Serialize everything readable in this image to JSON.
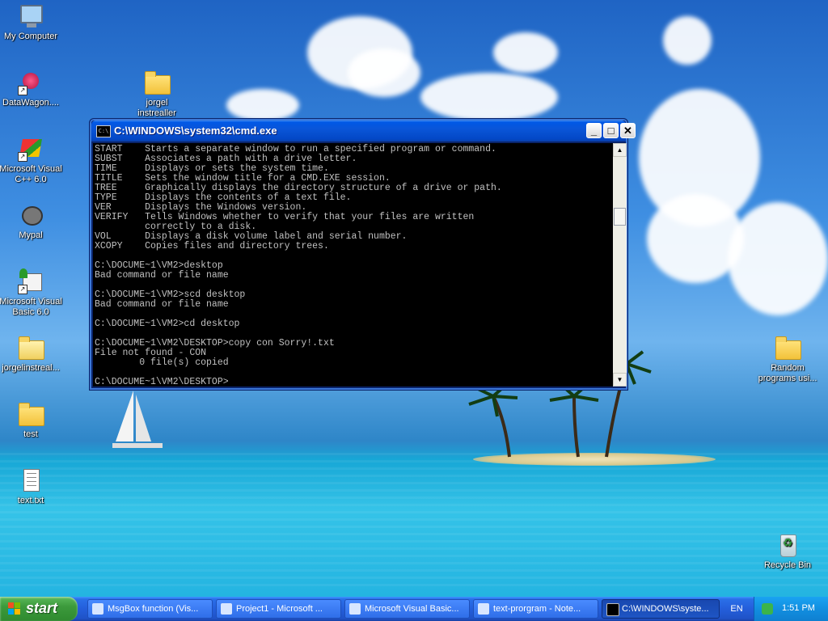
{
  "desktop": {
    "icons": [
      {
        "label": "My Computer",
        "icon": "my-computer-icon"
      },
      {
        "label": "DataWagon....",
        "icon": "datawagon-icon"
      },
      {
        "label": "jorgel instrealler",
        "icon": "folder-icon"
      },
      {
        "label": "Microsoft Visual C++ 6.0",
        "icon": "visual-cpp-icon"
      },
      {
        "label": "Mypal",
        "icon": "mypal-icon"
      },
      {
        "label": "Microsoft Visual Basic 6.0",
        "icon": "visual-basic-icon"
      },
      {
        "label": "jorgelinstreal...",
        "icon": "installer-icon"
      },
      {
        "label": "test",
        "icon": "folder-icon"
      },
      {
        "label": "text.txt",
        "icon": "text-file-icon"
      },
      {
        "label": "Random programs usi...",
        "icon": "folder-icon"
      },
      {
        "label": "Recycle Bin",
        "icon": "recycle-bin-icon"
      }
    ]
  },
  "cmd_window": {
    "title": "C:\\WINDOWS\\system32\\cmd.exe",
    "app_icon_text": "C:\\",
    "buttons": {
      "minimize": "_",
      "maximize": "□",
      "close": "✕"
    },
    "lines": [
      "START    Starts a separate window to run a specified program or command.",
      "SUBST    Associates a path with a drive letter.",
      "TIME     Displays or sets the system time.",
      "TITLE    Sets the window title for a CMD.EXE session.",
      "TREE     Graphically displays the directory structure of a drive or path.",
      "TYPE     Displays the contents of a text file.",
      "VER      Displays the Windows version.",
      "VERIFY   Tells Windows whether to verify that your files are written",
      "         correctly to a disk.",
      "VOL      Displays a disk volume label and serial number.",
      "XCOPY    Copies files and directory trees.",
      "",
      "C:\\DOCUME~1\\VM2>desktop",
      "Bad command or file name",
      "",
      "C:\\DOCUME~1\\VM2>scd desktop",
      "Bad command or file name",
      "",
      "C:\\DOCUME~1\\VM2>cd desktop",
      "",
      "C:\\DOCUME~1\\VM2\\DESKTOP>copy con Sorry!.txt",
      "File not found - CON",
      "        0 file(s) copied",
      "",
      "C:\\DOCUME~1\\VM2\\DESKTOP>"
    ]
  },
  "taskbar": {
    "start_label": "start",
    "tasks": [
      {
        "label": "MsgBox function (Vis...",
        "icon": "browser-icon",
        "active": false
      },
      {
        "label": "Project1 - Microsoft ...",
        "icon": "visual-basic-icon",
        "active": false
      },
      {
        "label": "Microsoft Visual Basic...",
        "icon": "visual-basic-icon",
        "active": false
      },
      {
        "label": "text-prorgram - Note...",
        "icon": "notepad-icon",
        "active": false
      },
      {
        "label": "C:\\WINDOWS\\syste...",
        "icon": "cmd-icon",
        "active": true
      }
    ],
    "language": "EN",
    "clock": "1:51 PM"
  },
  "colors": {
    "titlebar": "#0054e3",
    "taskbar": "#245edb",
    "start_button": "#3c9a3c",
    "console_text": "#c0c0c0",
    "console_bg": "#000000"
  }
}
